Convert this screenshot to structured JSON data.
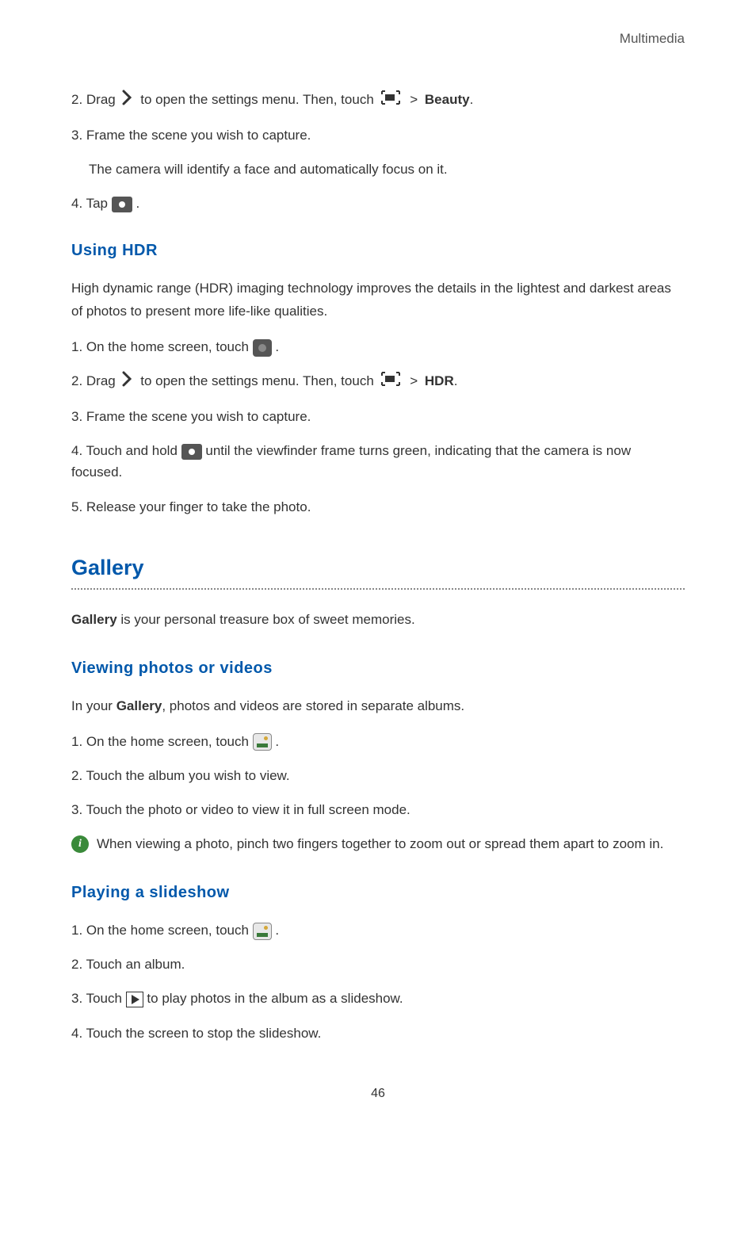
{
  "header": "Multimedia",
  "beauty_section": {
    "step2_prefix": "2. Drag ",
    "step2_mid": " to open the settings menu. Then, touch ",
    "step2_beauty": "Beauty",
    "step3": "3. Frame the scene you wish to capture.",
    "step3_sub": "The camera will identify a face and automatically focus on it.",
    "step4_prefix": "4. Tap ",
    "step4_suffix": "."
  },
  "hdr_section": {
    "heading": "Using HDR",
    "intro": "High dynamic range (HDR) imaging technology improves the details in the lightest and darkest areas of photos to present more life-like qualities.",
    "step1_prefix": "1. On the home screen, touch ",
    "step1_suffix": " .",
    "step2_prefix": "2. Drag ",
    "step2_mid": " to open the settings menu. Then, touch ",
    "step2_hdr": "HDR",
    "step3": "3. Frame the scene you wish to capture.",
    "step4_prefix": "4. Touch and hold ",
    "step4_suffix": "until the viewfinder frame turns green, indicating that the camera is now focused.",
    "step5": "5. Release your finger to take the photo."
  },
  "gallery_section": {
    "heading": "Gallery",
    "intro_bold": "Gallery",
    "intro_rest": " is your personal treasure box of sweet memories."
  },
  "viewing_section": {
    "heading": "Viewing photos or videos",
    "intro_prefix": "In your ",
    "intro_bold": "Gallery",
    "intro_suffix": ", photos and videos are stored in separate albums.",
    "step1_prefix": "1. On the home screen, touch ",
    "step1_suffix": " .",
    "step2": "2. Touch the album you wish to view.",
    "step3": "3. Touch the photo or video to view it in full screen mode.",
    "info": "When viewing a photo, pinch two fingers together to zoom out or spread them apart to zoom in."
  },
  "slideshow_section": {
    "heading": "Playing a slideshow",
    "step1_prefix": "1. On the home screen, touch ",
    "step1_suffix": " .",
    "step2": "2. Touch an album.",
    "step3_prefix": "3. Touch ",
    "step3_suffix": "to play photos in the album as a slideshow.",
    "step4": "4. Touch the screen to stop the slideshow."
  },
  "page_number": "46"
}
